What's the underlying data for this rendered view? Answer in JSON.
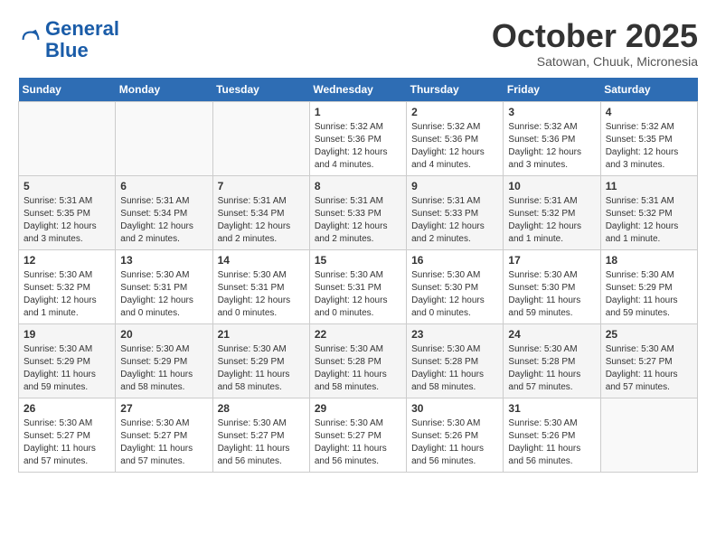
{
  "header": {
    "logo_line1": "General",
    "logo_line2": "Blue",
    "month": "October 2025",
    "location": "Satowan, Chuuk, Micronesia"
  },
  "days_of_week": [
    "Sunday",
    "Monday",
    "Tuesday",
    "Wednesday",
    "Thursday",
    "Friday",
    "Saturday"
  ],
  "weeks": [
    [
      {
        "day": "",
        "info": ""
      },
      {
        "day": "",
        "info": ""
      },
      {
        "day": "",
        "info": ""
      },
      {
        "day": "1",
        "info": "Sunrise: 5:32 AM\nSunset: 5:36 PM\nDaylight: 12 hours\nand 4 minutes."
      },
      {
        "day": "2",
        "info": "Sunrise: 5:32 AM\nSunset: 5:36 PM\nDaylight: 12 hours\nand 4 minutes."
      },
      {
        "day": "3",
        "info": "Sunrise: 5:32 AM\nSunset: 5:36 PM\nDaylight: 12 hours\nand 3 minutes."
      },
      {
        "day": "4",
        "info": "Sunrise: 5:32 AM\nSunset: 5:35 PM\nDaylight: 12 hours\nand 3 minutes."
      }
    ],
    [
      {
        "day": "5",
        "info": "Sunrise: 5:31 AM\nSunset: 5:35 PM\nDaylight: 12 hours\nand 3 minutes."
      },
      {
        "day": "6",
        "info": "Sunrise: 5:31 AM\nSunset: 5:34 PM\nDaylight: 12 hours\nand 2 minutes."
      },
      {
        "day": "7",
        "info": "Sunrise: 5:31 AM\nSunset: 5:34 PM\nDaylight: 12 hours\nand 2 minutes."
      },
      {
        "day": "8",
        "info": "Sunrise: 5:31 AM\nSunset: 5:33 PM\nDaylight: 12 hours\nand 2 minutes."
      },
      {
        "day": "9",
        "info": "Sunrise: 5:31 AM\nSunset: 5:33 PM\nDaylight: 12 hours\nand 2 minutes."
      },
      {
        "day": "10",
        "info": "Sunrise: 5:31 AM\nSunset: 5:32 PM\nDaylight: 12 hours\nand 1 minute."
      },
      {
        "day": "11",
        "info": "Sunrise: 5:31 AM\nSunset: 5:32 PM\nDaylight: 12 hours\nand 1 minute."
      }
    ],
    [
      {
        "day": "12",
        "info": "Sunrise: 5:30 AM\nSunset: 5:32 PM\nDaylight: 12 hours\nand 1 minute."
      },
      {
        "day": "13",
        "info": "Sunrise: 5:30 AM\nSunset: 5:31 PM\nDaylight: 12 hours\nand 0 minutes."
      },
      {
        "day": "14",
        "info": "Sunrise: 5:30 AM\nSunset: 5:31 PM\nDaylight: 12 hours\nand 0 minutes."
      },
      {
        "day": "15",
        "info": "Sunrise: 5:30 AM\nSunset: 5:31 PM\nDaylight: 12 hours\nand 0 minutes."
      },
      {
        "day": "16",
        "info": "Sunrise: 5:30 AM\nSunset: 5:30 PM\nDaylight: 12 hours\nand 0 minutes."
      },
      {
        "day": "17",
        "info": "Sunrise: 5:30 AM\nSunset: 5:30 PM\nDaylight: 11 hours\nand 59 minutes."
      },
      {
        "day": "18",
        "info": "Sunrise: 5:30 AM\nSunset: 5:29 PM\nDaylight: 11 hours\nand 59 minutes."
      }
    ],
    [
      {
        "day": "19",
        "info": "Sunrise: 5:30 AM\nSunset: 5:29 PM\nDaylight: 11 hours\nand 59 minutes."
      },
      {
        "day": "20",
        "info": "Sunrise: 5:30 AM\nSunset: 5:29 PM\nDaylight: 11 hours\nand 58 minutes."
      },
      {
        "day": "21",
        "info": "Sunrise: 5:30 AM\nSunset: 5:29 PM\nDaylight: 11 hours\nand 58 minutes."
      },
      {
        "day": "22",
        "info": "Sunrise: 5:30 AM\nSunset: 5:28 PM\nDaylight: 11 hours\nand 58 minutes."
      },
      {
        "day": "23",
        "info": "Sunrise: 5:30 AM\nSunset: 5:28 PM\nDaylight: 11 hours\nand 58 minutes."
      },
      {
        "day": "24",
        "info": "Sunrise: 5:30 AM\nSunset: 5:28 PM\nDaylight: 11 hours\nand 57 minutes."
      },
      {
        "day": "25",
        "info": "Sunrise: 5:30 AM\nSunset: 5:27 PM\nDaylight: 11 hours\nand 57 minutes."
      }
    ],
    [
      {
        "day": "26",
        "info": "Sunrise: 5:30 AM\nSunset: 5:27 PM\nDaylight: 11 hours\nand 57 minutes."
      },
      {
        "day": "27",
        "info": "Sunrise: 5:30 AM\nSunset: 5:27 PM\nDaylight: 11 hours\nand 57 minutes."
      },
      {
        "day": "28",
        "info": "Sunrise: 5:30 AM\nSunset: 5:27 PM\nDaylight: 11 hours\nand 56 minutes."
      },
      {
        "day": "29",
        "info": "Sunrise: 5:30 AM\nSunset: 5:27 PM\nDaylight: 11 hours\nand 56 minutes."
      },
      {
        "day": "30",
        "info": "Sunrise: 5:30 AM\nSunset: 5:26 PM\nDaylight: 11 hours\nand 56 minutes."
      },
      {
        "day": "31",
        "info": "Sunrise: 5:30 AM\nSunset: 5:26 PM\nDaylight: 11 hours\nand 56 minutes."
      },
      {
        "day": "",
        "info": ""
      }
    ]
  ]
}
